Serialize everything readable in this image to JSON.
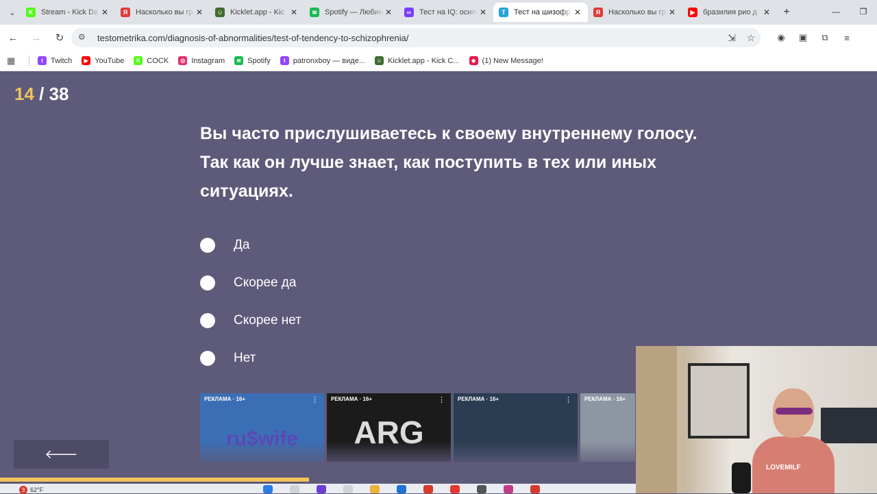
{
  "browser": {
    "tabs": [
      {
        "title": "Stream - Kick Da",
        "fav_color": "#53fc18",
        "fav_glyph": "K",
        "active": false
      },
      {
        "title": "Насколько вы гр",
        "fav_color": "#e03a3a",
        "fav_glyph": "Я",
        "active": false
      },
      {
        "title": "Kicklet.app - Kic",
        "fav_color": "#3e6b2f",
        "fav_glyph": "☺",
        "active": false
      },
      {
        "title": "Spotify — Любим",
        "fav_color": "#1db954",
        "fav_glyph": "≋",
        "active": false
      },
      {
        "title": "Тест на IQ: осил",
        "fav_color": "#7a3cff",
        "fav_glyph": "∞",
        "active": false
      },
      {
        "title": "Тест на шизофр",
        "fav_color": "#25a3d8",
        "fav_glyph": "T",
        "active": true
      },
      {
        "title": "Насколько вы гр",
        "fav_color": "#e03a3a",
        "fav_glyph": "Я",
        "active": false
      },
      {
        "title": "бразилия рио д",
        "fav_color": "#ff0000",
        "fav_glyph": "▶",
        "active": false
      }
    ],
    "url": "testometrika.com/diagnosis-of-abnormalities/test-of-tendency-to-schizophrenia/",
    "bookmarks": [
      {
        "label": "Twitch",
        "fav_color": "#9146ff",
        "fav_glyph": "t"
      },
      {
        "label": "YouTube",
        "fav_color": "#ff0000",
        "fav_glyph": "▶"
      },
      {
        "label": "COCK",
        "fav_color": "#53fc18",
        "fav_glyph": "K"
      },
      {
        "label": "Instagram",
        "fav_color": "#e1306c",
        "fav_glyph": "◎"
      },
      {
        "label": "Spotify",
        "fav_color": "#1db954",
        "fav_glyph": "≋"
      },
      {
        "label": "patronxboy — виде...",
        "fav_color": "#9146ff",
        "fav_glyph": "t"
      },
      {
        "label": "Kicklet.app - Kick C...",
        "fav_color": "#3e6b2f",
        "fav_glyph": "☺"
      },
      {
        "label": "(1) New Message!",
        "fav_color": "#e5194b",
        "fav_glyph": "◆"
      }
    ]
  },
  "quiz": {
    "current": "14",
    "separator": " / ",
    "total": "38",
    "question": "Вы часто прислушиваетесь к своему внутреннему голосу. Так как он лучше знает, как поступить в тех или иных ситуациях.",
    "options": [
      "Да",
      "Скорее да",
      "Скорее нет",
      "Нет"
    ],
    "back_label": "🡐",
    "progress_fraction": 0.352
  },
  "ads": [
    {
      "tag": "РЕКЛАМА · 16+",
      "brand": "ru$wife",
      "bg": "#3b6fb5",
      "brand_color": "#5b48b5"
    },
    {
      "tag": "РЕКЛАМА · 16+",
      "brand": "ARG",
      "bg": "#1b1b1b",
      "brand_color": "#dcdcdc"
    },
    {
      "tag": "РЕКЛАМА · 16+",
      "brand": "",
      "bg": "#2a3d52",
      "brand_color": "#ffffff"
    },
    {
      "tag": "РЕКЛАМА · 16+",
      "brand": "",
      "bg": "#8f96a3",
      "brand_color": "#ffffff"
    }
  ],
  "webcam": {
    "shirt_text": "LOVEMILF"
  },
  "taskbar": {
    "badge": "3",
    "weather": "62°F"
  },
  "colors": {
    "page_bg": "#5e5a7a",
    "accent": "#f2c45a",
    "back_button": "#4e4b66"
  }
}
